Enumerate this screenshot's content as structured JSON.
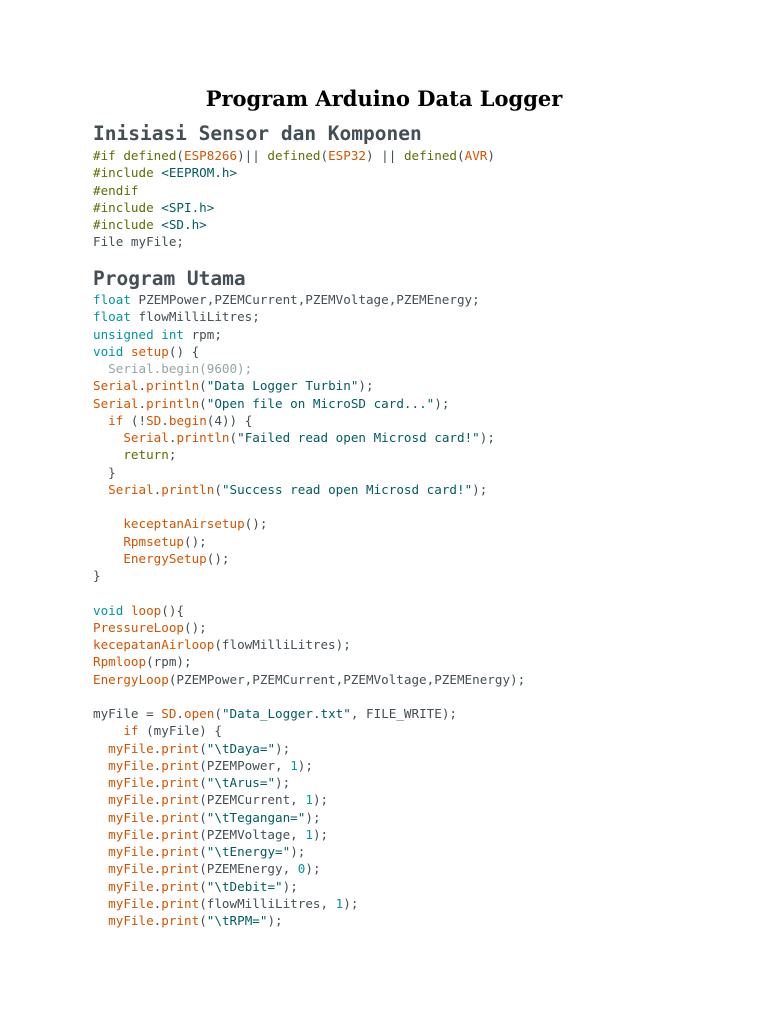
{
  "title": "Program Arduino Data Logger",
  "sections": [
    {
      "heading": "Inisiasi Sensor dan Komponen",
      "lines": [
        [
          [
            "pre",
            "#if defined"
          ],
          [
            "pl",
            "("
          ],
          [
            "fn",
            "ESP8266"
          ],
          [
            "pl",
            ")|| "
          ],
          [
            "pre",
            "defined"
          ],
          [
            "pl",
            "("
          ],
          [
            "fn",
            "ESP32"
          ],
          [
            "pl",
            ") || "
          ],
          [
            "pre",
            "defined"
          ],
          [
            "pl",
            "("
          ],
          [
            "fn",
            "AVR"
          ],
          [
            "pl",
            ")"
          ]
        ],
        [
          [
            "pre",
            "#include "
          ],
          [
            "str",
            "<EEPROM.h>"
          ]
        ],
        [
          [
            "pre",
            "#endif"
          ]
        ],
        [
          [
            "pre",
            "#include "
          ],
          [
            "str",
            "<SPI.h>"
          ]
        ],
        [
          [
            "pre",
            "#include "
          ],
          [
            "str",
            "<SD.h>"
          ]
        ],
        [
          [
            "pl",
            "File myFile;"
          ]
        ]
      ]
    },
    {
      "heading": "Program Utama",
      "lines": [
        [
          [
            "kw",
            "float"
          ],
          [
            "pl",
            " PZEMPower,PZEMCurrent,PZEMVoltage,PZEMEnergy;"
          ]
        ],
        [
          [
            "kw",
            "float"
          ],
          [
            "pl",
            " flowMilliLitres;"
          ]
        ],
        [
          [
            "kw",
            "unsigned int"
          ],
          [
            "pl",
            " rpm;"
          ]
        ],
        [
          [
            "kw",
            "void"
          ],
          [
            "pl",
            " "
          ],
          [
            "fn",
            "setup"
          ],
          [
            "pl",
            "() {"
          ]
        ],
        [
          [
            "dim",
            "  Serial.begin(9600);"
          ]
        ],
        [
          [
            "fn",
            "Serial"
          ],
          [
            "pl",
            "."
          ],
          [
            "fn",
            "println"
          ],
          [
            "pl",
            "("
          ],
          [
            "str",
            "\"Data Logger Turbin\""
          ],
          [
            "pl",
            ");"
          ]
        ],
        [
          [
            "fn",
            "Serial"
          ],
          [
            "pl",
            "."
          ],
          [
            "fn",
            "println"
          ],
          [
            "pl",
            "("
          ],
          [
            "str",
            "\"Open file on MicroSD card...\""
          ],
          [
            "pl",
            ");"
          ]
        ],
        [
          [
            "pl",
            "  "
          ],
          [
            "fn",
            "if"
          ],
          [
            "pl",
            " (!"
          ],
          [
            "fn",
            "SD"
          ],
          [
            "pl",
            "."
          ],
          [
            "fn",
            "begin"
          ],
          [
            "pl",
            "(4)) {"
          ]
        ],
        [
          [
            "pl",
            "    "
          ],
          [
            "fn",
            "Serial"
          ],
          [
            "pl",
            "."
          ],
          [
            "fn",
            "println"
          ],
          [
            "pl",
            "("
          ],
          [
            "str",
            "\"Failed read open Microsd card!\""
          ],
          [
            "pl",
            ");"
          ]
        ],
        [
          [
            "pl",
            "    "
          ],
          [
            "pre",
            "return"
          ],
          [
            "pl",
            ";"
          ]
        ],
        [
          [
            "pl",
            "  }"
          ]
        ],
        [
          [
            "pl",
            "  "
          ],
          [
            "fn",
            "Serial"
          ],
          [
            "pl",
            "."
          ],
          [
            "fn",
            "println"
          ],
          [
            "pl",
            "("
          ],
          [
            "str",
            "\"Success read open Microsd card!\""
          ],
          [
            "pl",
            ");"
          ]
        ],
        [
          [
            "pl",
            ""
          ]
        ],
        [
          [
            "pl",
            "    "
          ],
          [
            "fn",
            "keceptanAirsetup"
          ],
          [
            "pl",
            "();"
          ]
        ],
        [
          [
            "pl",
            "    "
          ],
          [
            "fn",
            "Rpmsetup"
          ],
          [
            "pl",
            "();"
          ]
        ],
        [
          [
            "pl",
            "    "
          ],
          [
            "fn",
            "EnergySetup"
          ],
          [
            "pl",
            "();"
          ]
        ],
        [
          [
            "pl",
            "}"
          ]
        ],
        [
          [
            "pl",
            ""
          ]
        ],
        [
          [
            "kw",
            "void"
          ],
          [
            "pl",
            " "
          ],
          [
            "fn",
            "loop"
          ],
          [
            "pl",
            "(){"
          ]
        ],
        [
          [
            "fn",
            "PressureLoop"
          ],
          [
            "pl",
            "();"
          ]
        ],
        [
          [
            "fn",
            "kecepatanAirloop"
          ],
          [
            "pl",
            "(flowMilliLitres);"
          ]
        ],
        [
          [
            "fn",
            "Rpmloop"
          ],
          [
            "pl",
            "(rpm);"
          ]
        ],
        [
          [
            "fn",
            "EnergyLoop"
          ],
          [
            "pl",
            "(PZEMPower,PZEMCurrent,PZEMVoltage,PZEMEnergy);"
          ]
        ],
        [
          [
            "pl",
            ""
          ]
        ],
        [
          [
            "pl",
            "myFile = "
          ],
          [
            "fn",
            "SD"
          ],
          [
            "pl",
            "."
          ],
          [
            "fn",
            "open"
          ],
          [
            "pl",
            "("
          ],
          [
            "str",
            "\"Data_Logger.txt\""
          ],
          [
            "pl",
            ", FILE_WRITE);"
          ]
        ],
        [
          [
            "pl",
            "    "
          ],
          [
            "fn",
            "if"
          ],
          [
            "pl",
            " (myFile) {"
          ]
        ],
        [
          [
            "pl",
            "  "
          ],
          [
            "fn",
            "myFile"
          ],
          [
            "pl",
            "."
          ],
          [
            "fn",
            "print"
          ],
          [
            "pl",
            "("
          ],
          [
            "str",
            "\"\\tDaya=\""
          ],
          [
            "pl",
            ");"
          ]
        ],
        [
          [
            "pl",
            "  "
          ],
          [
            "fn",
            "myFile"
          ],
          [
            "pl",
            "."
          ],
          [
            "fn",
            "print"
          ],
          [
            "pl",
            "(PZEMPower, "
          ],
          [
            "kw",
            "1"
          ],
          [
            "pl",
            ");"
          ]
        ],
        [
          [
            "pl",
            "  "
          ],
          [
            "fn",
            "myFile"
          ],
          [
            "pl",
            "."
          ],
          [
            "fn",
            "print"
          ],
          [
            "pl",
            "("
          ],
          [
            "str",
            "\"\\tArus=\""
          ],
          [
            "pl",
            ");"
          ]
        ],
        [
          [
            "pl",
            "  "
          ],
          [
            "fn",
            "myFile"
          ],
          [
            "pl",
            "."
          ],
          [
            "fn",
            "print"
          ],
          [
            "pl",
            "(PZEMCurrent, "
          ],
          [
            "kw",
            "1"
          ],
          [
            "pl",
            ");"
          ]
        ],
        [
          [
            "pl",
            "  "
          ],
          [
            "fn",
            "myFile"
          ],
          [
            "pl",
            "."
          ],
          [
            "fn",
            "print"
          ],
          [
            "pl",
            "("
          ],
          [
            "str",
            "\"\\tTegangan=\""
          ],
          [
            "pl",
            ");"
          ]
        ],
        [
          [
            "pl",
            "  "
          ],
          [
            "fn",
            "myFile"
          ],
          [
            "pl",
            "."
          ],
          [
            "fn",
            "print"
          ],
          [
            "pl",
            "(PZEMVoltage, "
          ],
          [
            "kw",
            "1"
          ],
          [
            "pl",
            ");"
          ]
        ],
        [
          [
            "pl",
            "  "
          ],
          [
            "fn",
            "myFile"
          ],
          [
            "pl",
            "."
          ],
          [
            "fn",
            "print"
          ],
          [
            "pl",
            "("
          ],
          [
            "str",
            "\"\\tEnergy=\""
          ],
          [
            "pl",
            ");"
          ]
        ],
        [
          [
            "pl",
            "  "
          ],
          [
            "fn",
            "myFile"
          ],
          [
            "pl",
            "."
          ],
          [
            "fn",
            "print"
          ],
          [
            "pl",
            "(PZEMEnergy, "
          ],
          [
            "kw",
            "0"
          ],
          [
            "pl",
            ");"
          ]
        ],
        [
          [
            "pl",
            "  "
          ],
          [
            "fn",
            "myFile"
          ],
          [
            "pl",
            "."
          ],
          [
            "fn",
            "print"
          ],
          [
            "pl",
            "("
          ],
          [
            "str",
            "\"\\tDebit=\""
          ],
          [
            "pl",
            ");"
          ]
        ],
        [
          [
            "pl",
            "  "
          ],
          [
            "fn",
            "myFile"
          ],
          [
            "pl",
            "."
          ],
          [
            "fn",
            "print"
          ],
          [
            "pl",
            "(flowMilliLitres, "
          ],
          [
            "kw",
            "1"
          ],
          [
            "pl",
            ");"
          ]
        ],
        [
          [
            "pl",
            "  "
          ],
          [
            "fn",
            "myFile"
          ],
          [
            "pl",
            "."
          ],
          [
            "fn",
            "print"
          ],
          [
            "pl",
            "("
          ],
          [
            "str",
            "\"\\tRPM=\""
          ],
          [
            "pl",
            ");"
          ]
        ]
      ]
    }
  ]
}
